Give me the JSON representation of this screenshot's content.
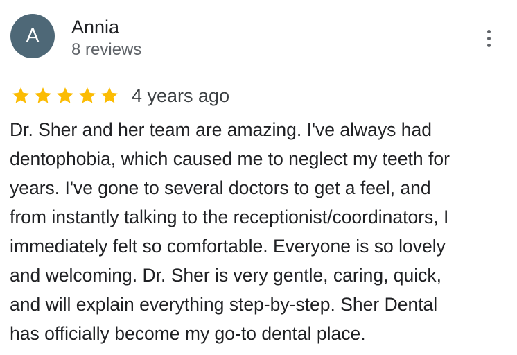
{
  "colors": {
    "avatar_bg": "#4e6877",
    "star": "#fbbc04"
  },
  "reviewer": {
    "initial": "A",
    "name": "Annia",
    "review_count": "8 reviews"
  },
  "menu": {
    "icon": "more-vertical-icon"
  },
  "rating": {
    "stars": 5,
    "max_stars": 5,
    "time_ago": "4 years ago"
  },
  "review": {
    "lines": [
      "Dr. Sher and her team are amazing. I've always had",
      "dentophobia, which caused me to neglect my teeth for",
      "years. I've gone to several doctors to get a feel, and",
      "from instantly talking to the receptionist/coordinators, I",
      "immediately felt so comfortable. Everyone is so lovely",
      "and welcoming. Dr. Sher is very gentle, caring, quick,",
      "and will explain everything step-by-step. Sher Dental",
      "has officially become my go-to dental place."
    ]
  }
}
